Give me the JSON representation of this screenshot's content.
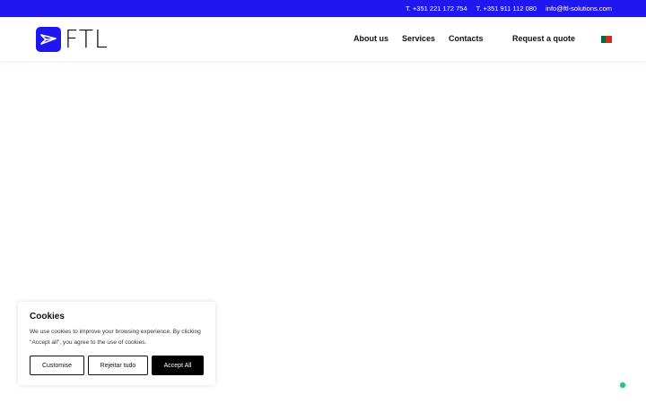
{
  "topbar": {
    "phone1": "T. +351 221 172 754",
    "phone2": "T. +351 911 112 080",
    "email": "info@ftl-solutions.com",
    "background": "#1f16f0"
  },
  "logo": {
    "text": "FTL",
    "icon": "paper-plane-icon",
    "color": "#1f16f0"
  },
  "nav": {
    "about": "About us",
    "services": "Services",
    "contacts": "Contacts",
    "quote": "Request a quote",
    "language_flag": "portugal-flag-icon"
  },
  "cookie": {
    "title": "Cookies",
    "text": "We use cookies to improve your browsing experience. By clicking \"Accept all\", you agree to the use of cookies.",
    "customise": "Customise",
    "reject": "Rejeitar tudo",
    "accept": "Accept All"
  },
  "status_indicator": {
    "icon": "online-dot-icon",
    "color": "#2ebf7a"
  }
}
